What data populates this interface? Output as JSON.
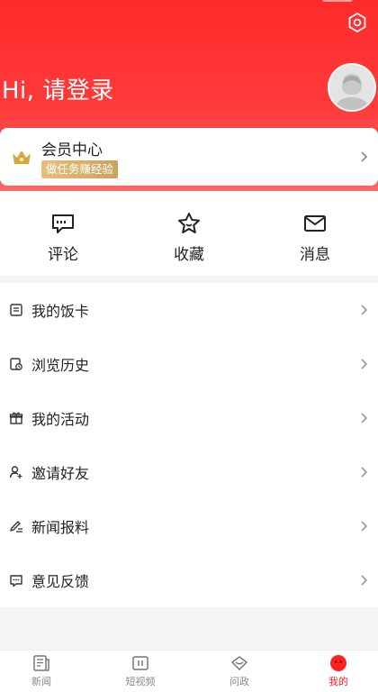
{
  "header": {
    "greeting": "Hi, 请登录"
  },
  "member": {
    "title": "会员中心",
    "badge": "做任务赚经验"
  },
  "quick_actions": [
    {
      "label": "评论",
      "icon": "comment-icon"
    },
    {
      "label": "收藏",
      "icon": "star-icon"
    },
    {
      "label": "消息",
      "icon": "mail-icon"
    }
  ],
  "menu": [
    {
      "label": "我的饭卡",
      "icon": "card-icon"
    },
    {
      "label": "浏览历史",
      "icon": "history-icon"
    },
    {
      "label": "我的活动",
      "icon": "gift-icon"
    },
    {
      "label": "邀请好友",
      "icon": "invite-user-icon"
    },
    {
      "label": "新闻报料",
      "icon": "pen-icon"
    },
    {
      "label": "意见反馈",
      "icon": "feedback-icon"
    }
  ],
  "tabs": [
    {
      "label": "新闻",
      "icon": "news-icon",
      "active": false
    },
    {
      "label": "短视频",
      "icon": "video-icon",
      "active": false
    },
    {
      "label": "问政",
      "icon": "ask-icon",
      "active": false
    },
    {
      "label": "我的",
      "icon": "profile-icon",
      "active": true
    }
  ],
  "colors": {
    "brand": "#ff2b2b",
    "active_tab": "#ff2222",
    "badge_gold": "#caa35d"
  }
}
